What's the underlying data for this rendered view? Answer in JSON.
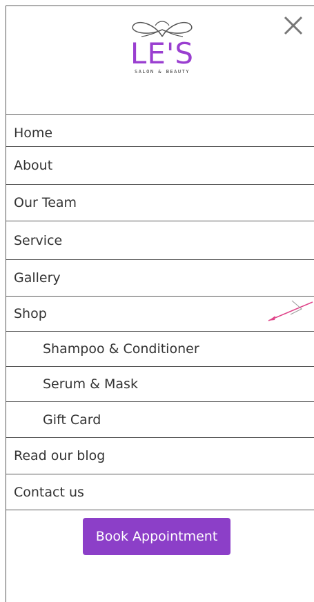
{
  "brand": {
    "logo_main": "LE'S",
    "logo_sub": "SALON & BEAUTY",
    "accent_color": "#9a3fd0"
  },
  "header": {
    "close_icon": "close-icon"
  },
  "menu": {
    "items": [
      {
        "label": "Home",
        "level": 0
      },
      {
        "label": "About",
        "level": 0
      },
      {
        "label": "Our Team",
        "level": 0
      },
      {
        "label": "Service",
        "level": 0
      },
      {
        "label": "Gallery",
        "level": 0
      },
      {
        "label": "Shop",
        "level": 0,
        "expanded": true
      },
      {
        "label": "Shampoo & Conditioner",
        "level": 1
      },
      {
        "label": "Serum & Mask",
        "level": 1
      },
      {
        "label": "Gift Card",
        "level": 1
      },
      {
        "label": "Read our blog",
        "level": 0
      },
      {
        "label": "Contact us",
        "level": 0
      }
    ]
  },
  "cta": {
    "label": "Book Appointment",
    "color": "#8c3fc8"
  }
}
